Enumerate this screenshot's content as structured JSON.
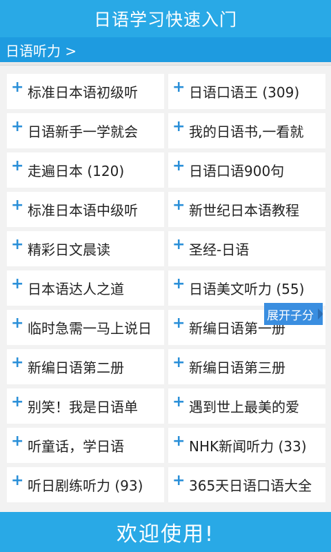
{
  "header": {
    "title": "日语学习快速入门"
  },
  "breadcrumb": {
    "label": "日语听力 >"
  },
  "items": [
    {
      "label": "标准日本语初级听"
    },
    {
      "label": "日语口语王 (309)"
    },
    {
      "label": "日语新手一学就会"
    },
    {
      "label": "我的日语书,一看就"
    },
    {
      "label": "走遍日本 (120)"
    },
    {
      "label": "日语口语900句"
    },
    {
      "label": "标准日本语中级听"
    },
    {
      "label": "新世纪日本语教程"
    },
    {
      "label": "精彩日文晨读"
    },
    {
      "label": "圣经-日语"
    },
    {
      "label": "日本语达人之道"
    },
    {
      "label": "日语美文听力 (55)"
    },
    {
      "label": "临时急需一马上说日"
    },
    {
      "label": "新编日语第一册"
    },
    {
      "label": "新编日语第二册"
    },
    {
      "label": "新编日语第三册"
    },
    {
      "label": "别笑！我是日语单"
    },
    {
      "label": "遇到世上最美的爱"
    },
    {
      "label": "听童话，学日语"
    },
    {
      "label": "NHK新闻听力 (33)"
    },
    {
      "label": "听日剧练听力 (93)"
    },
    {
      "label": "365天日语口语大全"
    }
  ],
  "expand": {
    "label": "展开子分"
  },
  "footer": {
    "label": "欢迎使用!"
  },
  "colors": {
    "accent": "#29a9e6",
    "plus": "#2a8fd8",
    "expand": "#3a8ee0"
  }
}
